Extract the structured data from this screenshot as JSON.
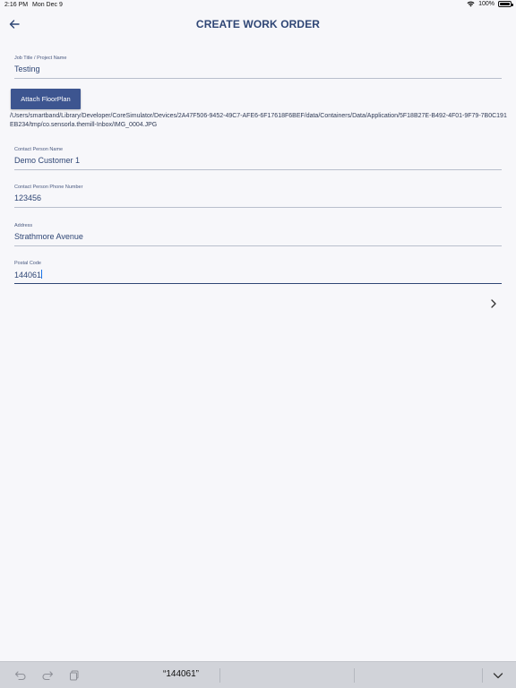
{
  "status_bar": {
    "time": "2:16 PM",
    "date": "Mon Dec 9",
    "battery": "100%"
  },
  "nav": {
    "title": "CREATE WORK ORDER"
  },
  "form": {
    "job_title": {
      "label": "Job Title / Project Name",
      "value": "Testing"
    },
    "attach_button": "Attach FloorPlan",
    "file_path": "/Users/smartband/Library/Developer/CoreSimulator/Devices/2A47F506-9452-49C7-AFE6-6F17618F6BEF/data/Containers/Data/Application/5F18B27E-B492-4F01-9F79-7B0C191EB234/tmp/co.sensorla.themill-Inbox/IMG_0004.JPG",
    "contact_name": {
      "label": "Contact Person Name",
      "value": "Demo Customer 1"
    },
    "contact_phone": {
      "label": "Contact Person Phone Number",
      "value": "123456"
    },
    "address": {
      "label": "Address",
      "value": "Strathmore Avenue"
    },
    "postal_code": {
      "label": "Postal Code",
      "value": "144061"
    }
  },
  "keyboard_bar": {
    "suggestion": "“144061”"
  },
  "colors": {
    "accent": "#2f4675",
    "button": "#3d5590",
    "background": "#f7f7fa"
  }
}
